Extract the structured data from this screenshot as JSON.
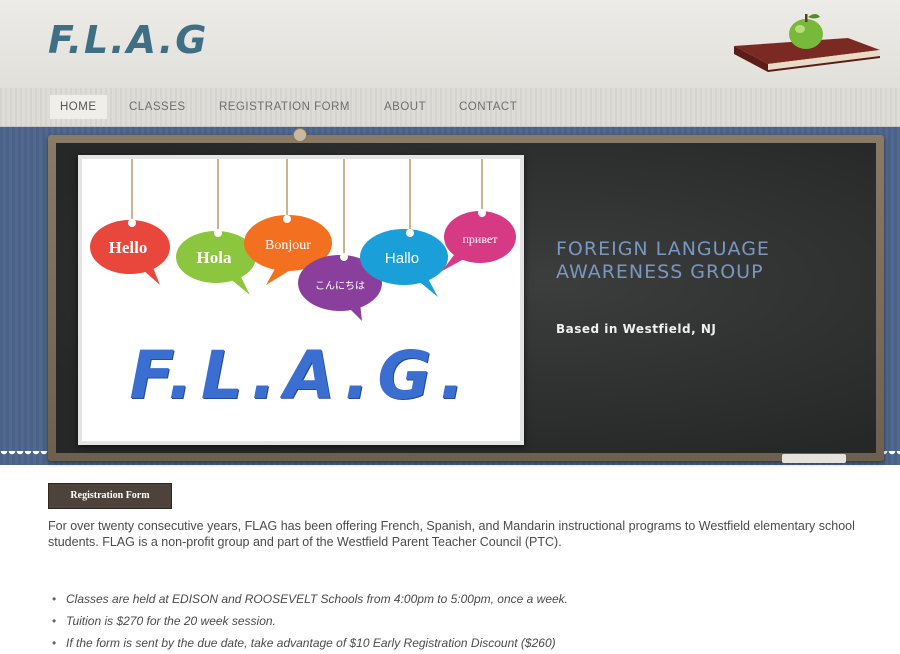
{
  "header": {
    "logo": "F.L.A.G"
  },
  "nav": {
    "items": [
      {
        "label": "HOME",
        "active": true
      },
      {
        "label": "CLASSES",
        "active": false
      },
      {
        "label": "REGISTRATION FORM",
        "active": false
      },
      {
        "label": "ABOUT",
        "active": false
      },
      {
        "label": "CONTACT",
        "active": false
      }
    ]
  },
  "banner": {
    "poster": {
      "bubbles": [
        {
          "text": "Hello",
          "color": "#e9463c"
        },
        {
          "text": "Hola",
          "color": "#8cc63f"
        },
        {
          "text": "Bonjour",
          "color": "#f37021"
        },
        {
          "text": "こんにちは",
          "color": "#8a3f9c"
        },
        {
          "text": "Hallo",
          "color": "#1b9fd9"
        },
        {
          "text": "привет",
          "color": "#d63a84"
        }
      ],
      "title": "F.L.A.G."
    },
    "heading_line1": "FOREIGN LANGUAGE",
    "heading_line2": "AWARENESS GROUP",
    "subtitle": "Based in Westfield, NJ"
  },
  "content": {
    "button_label": "Registration Form",
    "intro": "For over twenty consecutive years, FLAG has been offering French, Spanish, and Mandarin instructional programs to Westfield elementary school students. FLAG is a non-profit group and part of the Westfield Parent Teacher Council (PTC).",
    "bullets": [
      "Classes are held at EDISON and ROOSEVELT Schools from 4:00pm to 5:00pm, once a week.",
      "Tuition is $270 for the 20 week session.",
      "If the form is sent by the due date,  take advantage of $10 Early Registration Discount ($260)"
    ]
  },
  "colors": {
    "logo": "#3f6f85",
    "banner_blue": "#4a6287",
    "chalkboard": "#2e2f2f",
    "button": "#4e433b"
  },
  "icons": [
    "apple-on-book-icon"
  ]
}
